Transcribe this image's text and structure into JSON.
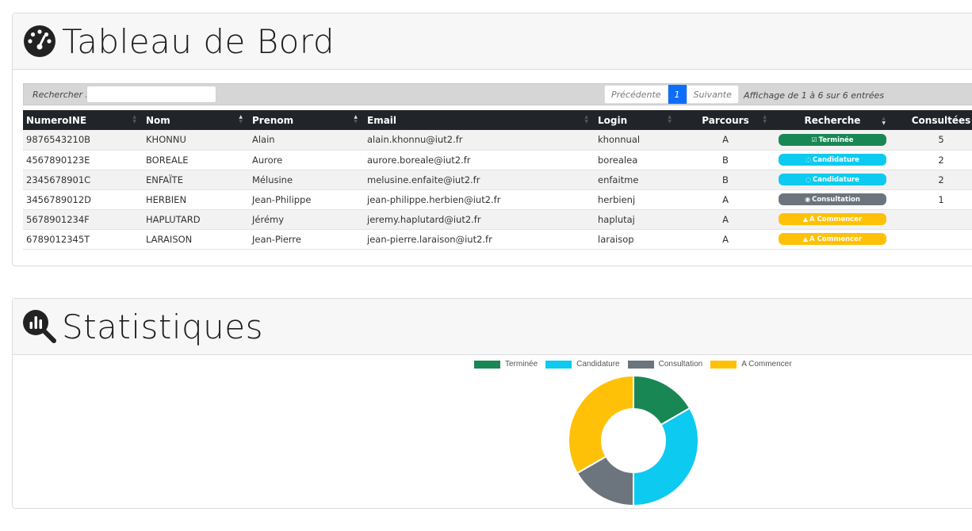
{
  "dashboard": {
    "title": "Tableau de Bord",
    "search_label": "Rechercher :",
    "search_value": "",
    "pager": {
      "prev": "Précédente",
      "current": "1",
      "next": "Suivante"
    },
    "info": "Affichage de 1 à 6 sur 6 entrées",
    "columns": [
      "NumeroINE",
      "Nom",
      "Prenom",
      "Email",
      "Login",
      "Parcours",
      "Recherche",
      "Consultées"
    ],
    "rows": [
      {
        "ine": "9876543210B",
        "nom": "KHONNU",
        "prenom": "Alain",
        "email": "alain.khonnu@iut2.fr",
        "login": "khonnual",
        "parcours": "A",
        "status": "Terminée",
        "status_icon": "check-square-icon",
        "status_color": "#198754",
        "consultees": "5"
      },
      {
        "ine": "4567890123E",
        "nom": "BOREALE",
        "prenom": "Aurore",
        "email": "aurore.boreale@iut2.fr",
        "login": "borealea",
        "parcours": "B",
        "status": "Candidature",
        "status_icon": "spinner-icon",
        "status_color": "#0dcaf0",
        "consultees": "2"
      },
      {
        "ine": "2345678901C",
        "nom": "ENFAÏTE",
        "prenom": "Mélusine",
        "email": "melusine.enfaite@iut2.fr",
        "login": "enfaitme",
        "parcours": "B",
        "status": "Candidature",
        "status_icon": "spinner-icon",
        "status_color": "#0dcaf0",
        "consultees": "2"
      },
      {
        "ine": "3456789012D",
        "nom": "HERBIEN",
        "prenom": "Jean-Philippe",
        "email": "jean-philippe.herbien@iut2.fr",
        "login": "herbienj",
        "parcours": "A",
        "status": "Consultation",
        "status_icon": "eye-icon",
        "status_color": "#6c757d",
        "consultees": "1"
      },
      {
        "ine": "5678901234F",
        "nom": "HAPLUTARD",
        "prenom": "Jérémy",
        "email": "jeremy.haplutard@iut2.fr",
        "login": "haplutaj",
        "parcours": "A",
        "status": "A Commencer",
        "status_icon": "warning-icon",
        "status_color": "#ffc107",
        "consultees": ""
      },
      {
        "ine": "6789012345T",
        "nom": "LARAISON",
        "prenom": "Jean-Pierre",
        "email": "jean-pierre.laraison@iut2.fr",
        "login": "laraisop",
        "parcours": "A",
        "status": "A Commencer",
        "status_icon": "warning-icon",
        "status_color": "#ffc107",
        "consultees": ""
      }
    ]
  },
  "stats": {
    "title": "Statistiques"
  },
  "chart_data": {
    "type": "pie",
    "categories": [
      "Terminée",
      "Candidature",
      "Consultation",
      "A Commencer"
    ],
    "values": [
      1,
      2,
      1,
      2
    ],
    "colors": [
      "#198754",
      "#0dcaf0",
      "#6c757d",
      "#ffc107"
    ],
    "legend": "top"
  }
}
